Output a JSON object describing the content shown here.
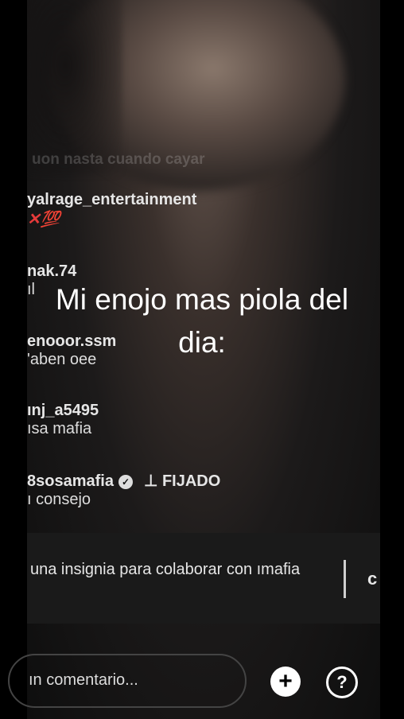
{
  "faded_comment": "uon nasta cuando cayar",
  "comments": [
    {
      "user": "yalrage_entertainment",
      "badge": "✕💯"
    },
    {
      "user": "nak.74",
      "msg": "ıl"
    },
    {
      "user": "enooor.ssm",
      "msg": "'aben oee"
    },
    {
      "user": "ınj_a5495",
      "msg": "ısa mafia"
    },
    {
      "user": "8sosamafia",
      "pinned": "FIJADO",
      "msg": "ı consejo"
    }
  ],
  "overlay_line1": "Mi enojo mas piola del",
  "overlay_line2": "dia:",
  "collab_text": "una insignia para colaborar con ımafia",
  "collab_c": "c",
  "comment_placeholder": "ın comentario...",
  "icons": {
    "verified": "verified-icon",
    "pin": "pin-icon",
    "add": "plus-icon",
    "help": "question-icon"
  }
}
